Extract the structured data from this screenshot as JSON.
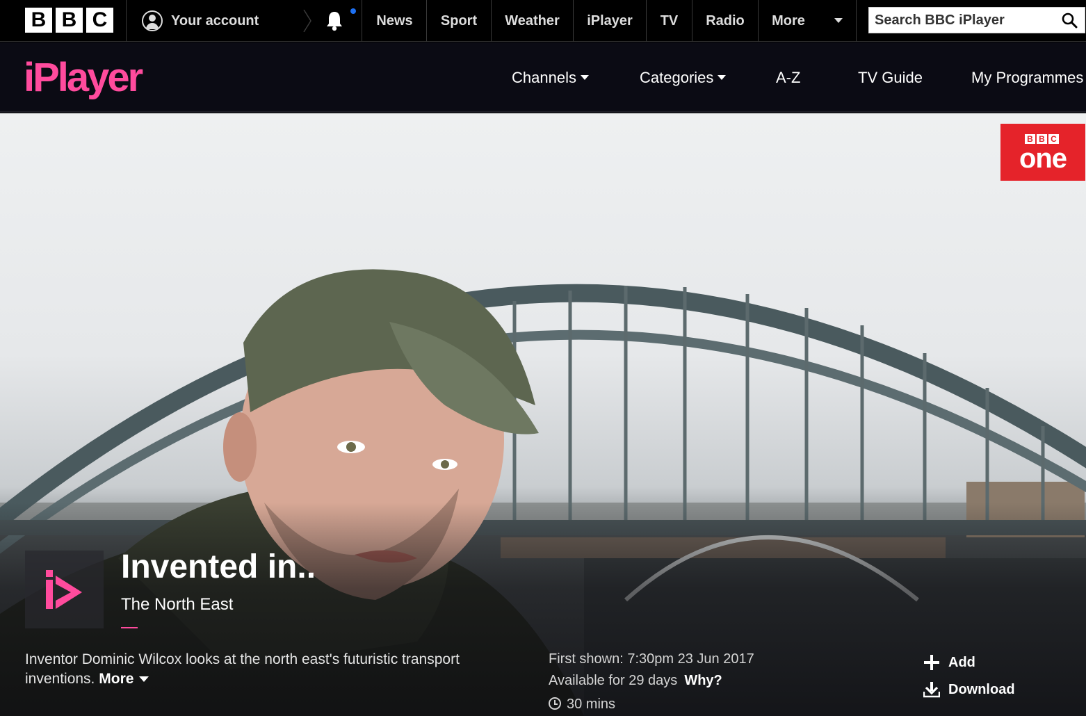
{
  "bbc_bar": {
    "logo_letters": [
      "B",
      "B",
      "C"
    ],
    "account_label": "Your account",
    "nav": [
      "News",
      "Sport",
      "Weather",
      "iPlayer",
      "TV",
      "Radio",
      "More"
    ],
    "search_placeholder": "Search BBC iPlayer",
    "notification_dot_color": "#1d70f2"
  },
  "iplayer_bar": {
    "logo_text": "iPlayer",
    "brand_color": "#ff4b9d",
    "nav": {
      "channels": "Channels",
      "categories": "Categories",
      "az": "A-Z",
      "tv_guide": "TV Guide",
      "my_programmes": "My Programmes"
    }
  },
  "channel_badge": {
    "bbc_letters": [
      "B",
      "B",
      "C"
    ],
    "channel": "one",
    "color": "#e5232a"
  },
  "programme": {
    "title": "Invented in..",
    "subtitle": "The North East",
    "synopsis": "Inventor Dominic Wilcox looks at the north east's futuristic transport inventions.",
    "more_label": "More",
    "first_shown": "First shown: 7:30pm 23 Jun 2017",
    "availability": "Available for 29 days",
    "why_label": "Why?",
    "duration": "30 mins"
  },
  "actions": {
    "add_label": "Add",
    "download_label": "Download"
  }
}
